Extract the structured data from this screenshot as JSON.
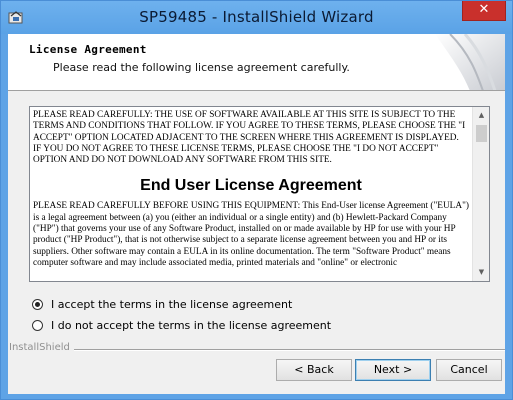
{
  "window": {
    "title": "SP59485 - InstallShield Wizard",
    "close_glyph": "✕",
    "icon": "installshield-app-icon"
  },
  "header": {
    "title": "License Agreement",
    "subtitle": "Please read the following license agreement carefully."
  },
  "license": {
    "intro": "PLEASE READ CAREFULLY: THE USE OF SOFTWARE AVAILABLE AT THIS SITE IS SUBJECT TO THE TERMS AND CONDITIONS THAT FOLLOW. IF YOU AGREE TO THESE TERMS, PLEASE CHOOSE THE \"I ACCEPT\" OPTION LOCATED ADJACENT TO THE SCREEN WHERE THIS AGREEMENT IS DISPLAYED. IF YOU DO NOT AGREE TO THESE LICENSE TERMS, PLEASE CHOOSE THE \"I DO NOT ACCEPT\" OPTION AND DO NOT DOWNLOAD ANY SOFTWARE FROM THIS SITE.",
    "heading": "End User License Agreement",
    "body": "PLEASE READ CAREFULLY BEFORE USING THIS EQUIPMENT: This End-User license Agreement (\"EULA\") is a legal agreement between (a) you (either an individual or a single entity) and (b) Hewlett-Packard Company (\"HP\") that governs your use of any Software Product, installed on or made available by HP for use with your HP product (\"HP Product\"), that is not otherwise subject to a separate license agreement between you and HP or its suppliers. Other software may contain a EULA in its online documentation. The term \"Software Product\" means computer software and may include associated media, printed materials and \"online\" or electronic"
  },
  "options": {
    "accept_label": "I accept the terms in the license agreement",
    "decline_label": "I do not accept the terms in the license agreement",
    "selected": "accept"
  },
  "footer": {
    "brand": "InstallShield",
    "back_label": "< Back",
    "next_label": "Next >",
    "cancel_label": "Cancel"
  },
  "colors": {
    "titlebar": "#5aa2e6",
    "close": "#c9302c",
    "dialog_bg": "#f0f0f0"
  }
}
